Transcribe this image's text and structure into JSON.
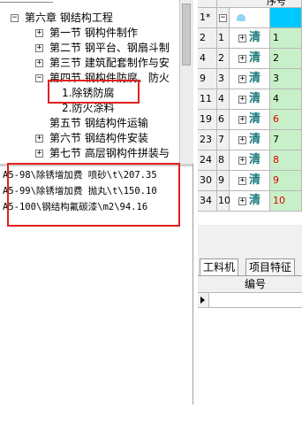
{
  "tree": {
    "items": [
      {
        "label": "第六章  钢结构工程",
        "level": 0,
        "expander": "minus"
      },
      {
        "label": "第一节  钢构件制作",
        "level": 1,
        "expander": "plus"
      },
      {
        "label": "第二节  钢平台、钢扇斗制",
        "level": 1,
        "expander": "plus"
      },
      {
        "label": "第三节  建筑配套制作与安",
        "level": 1,
        "expander": "plus"
      },
      {
        "label": "第四节  钢构件防腐、防火",
        "level": 1,
        "expander": "minus"
      },
      {
        "label": "1.除锈防腐",
        "level": 2,
        "expander": "none"
      },
      {
        "label": "2.防火涂料",
        "level": 2,
        "expander": "none"
      },
      {
        "label": "第五节  钢结构件运输",
        "level": 1,
        "expander": "none"
      },
      {
        "label": "第六节  钢结构件安装",
        "level": 1,
        "expander": "plus"
      },
      {
        "label": "第七节  高层钢构件拼装与",
        "level": 1,
        "expander": "plus"
      }
    ]
  },
  "list": {
    "items": [
      "A5-98\\除锈增加费 喷砂\\t\\207.35",
      "A5-99\\除锈增加费 抛丸\\t\\150.10",
      "A5-100\\钢结构氟碳漆\\m2\\94.16"
    ]
  },
  "grid": {
    "header": {
      "rowno": "1*",
      "col": "序号"
    },
    "rows": [
      {
        "rowno": "2",
        "col2": "1",
        "name": "清",
        "seq": "1",
        "red": false
      },
      {
        "rowno": "4",
        "col2": "2",
        "name": "清",
        "seq": "2",
        "red": false
      },
      {
        "rowno": "9",
        "col2": "3",
        "name": "清",
        "seq": "3",
        "red": false
      },
      {
        "rowno": "11",
        "col2": "4",
        "name": "清",
        "seq": "4",
        "red": false
      },
      {
        "rowno": "19",
        "col2": "6",
        "name": "清",
        "seq": "6",
        "red": true
      },
      {
        "rowno": "23",
        "col2": "7",
        "name": "清",
        "seq": "7",
        "red": false
      },
      {
        "rowno": "24",
        "col2": "8",
        "name": "清",
        "seq": "8",
        "red": true
      },
      {
        "rowno": "30",
        "col2": "9",
        "name": "清",
        "seq": "9",
        "red": true
      },
      {
        "rowno": "34",
        "col2": "10",
        "name": "清",
        "seq": "10",
        "red": true
      }
    ]
  },
  "tabs": [
    "工料机",
    "项目特征"
  ],
  "bottom": {
    "header": "编号"
  },
  "colors": {
    "highlight": "#e02020",
    "green_cell": "#c8f0c8",
    "cyan_header": "#00c8ff"
  }
}
